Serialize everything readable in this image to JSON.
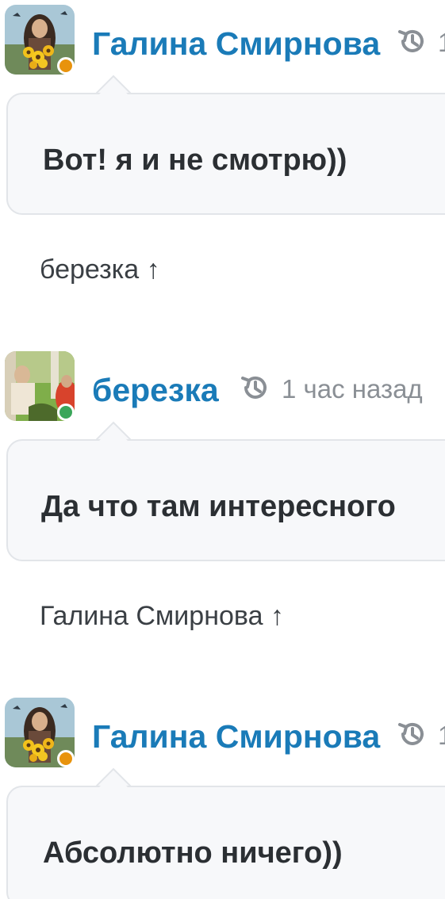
{
  "comments": [
    {
      "author": "Галина Смирнова",
      "status_color": "#e8930c",
      "time_text": "1",
      "text": "Вот! я и не смотрю))",
      "reply_to": "березка ↑"
    },
    {
      "author": "березка",
      "status_color": "#3aa65a",
      "time_text": "1 час назад",
      "text": "Да что там интересного",
      "reply_to": "Галина Смирнова ↑"
    },
    {
      "author": "Галина Смирнова",
      "status_color": "#e8930c",
      "time_text": "1",
      "text": "Абсолютно ничего))"
    }
  ],
  "colors": {
    "author_link": "#1a7bb8",
    "bubble_bg": "#f7f8fa",
    "bubble_border": "#e2e5e9",
    "meta_gray": "#8a8f95"
  },
  "icons": {
    "history": "history-clock-icon",
    "online_status": "status-dot"
  }
}
